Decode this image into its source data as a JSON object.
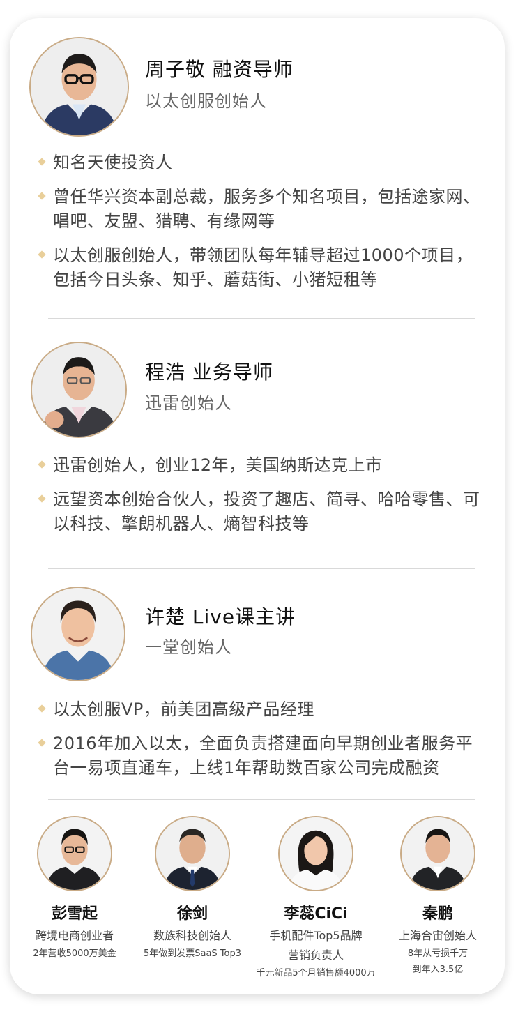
{
  "mentors": [
    {
      "name": "周子敬 融资导师",
      "title": "以太创服创始人",
      "bullets": [
        "知名天使投资人",
        "曾任华兴资本副总裁，服务多个知名项目，包括途家网、唱吧、友盟、猎聘、有缘网等",
        "以太创服创始人，带领团队每年辅导超过1000个项目，包括今日头条、知乎、蘑菇街、小猪短租等"
      ],
      "photo_icon": "portrait-glasses-suit"
    },
    {
      "name": "程浩 业务导师",
      "title": "迅雷创始人",
      "bullets": [
        "迅雷创始人，创业12年，美国纳斯达克上市",
        "远望资本创始合伙人，投资了趣店、简寻、哈哈零售、可以科技、擎朗机器人、熵智科技等"
      ],
      "photo_icon": "portrait-suit-fist"
    },
    {
      "name": "许楚 Live课主讲",
      "title": "一堂创始人",
      "bullets": [
        "以太创服VP，前美团高级产品经理",
        "2016年加入以太，全面负责搭建面向早期创业者服务平台一易项直通车，上线1年帮助数百家公司完成融资"
      ],
      "photo_icon": "portrait-blue-shirt"
    }
  ],
  "small_mentors": [
    {
      "name": "彭雪起",
      "lines": [
        "跨境电商创业者"
      ],
      "small": [
        "2年营收5000万美金"
      ],
      "photo_icon": "portrait-glasses"
    },
    {
      "name": "徐剑",
      "lines": [
        "数族科技创始人"
      ],
      "small": [
        "5年做到发票SaaS Top3"
      ],
      "photo_icon": "portrait-suit-tie"
    },
    {
      "name": "李蕊CiCi",
      "lines": [
        "手机配件Top5品牌",
        "营销负责人"
      ],
      "small": [
        "千元新品5个月销售额4000万"
      ],
      "photo_icon": "portrait-woman"
    },
    {
      "name": "秦鹏",
      "lines": [
        "上海合宙创始人"
      ],
      "small": [
        "8年从亏损千万",
        "到年入3.5亿"
      ],
      "photo_icon": "portrait-suit"
    }
  ],
  "colors": {
    "border": "#c9ab86",
    "bullet": "#e9cf9a",
    "divider": "#d9d9d9"
  }
}
